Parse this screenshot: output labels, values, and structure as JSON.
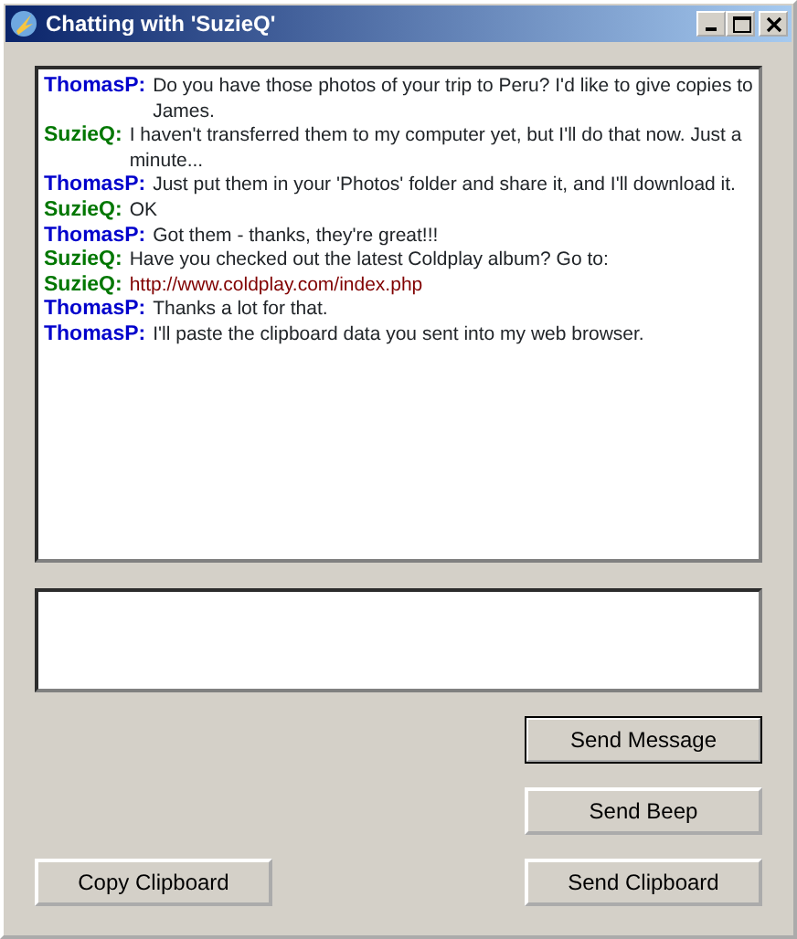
{
  "window": {
    "title": "Chatting with 'SuzieQ'"
  },
  "messages": [
    {
      "sender": "ThomasP:",
      "color": "#0000cc",
      "kind": "text",
      "text": "Do you have those photos of your trip to Peru? I'd like to give copies to James."
    },
    {
      "sender": "SuzieQ:",
      "color": "#007700",
      "kind": "text",
      "text": "I haven't transferred them to my computer yet, but I'll do that now. Just a minute..."
    },
    {
      "sender": "ThomasP:",
      "color": "#0000cc",
      "kind": "text",
      "text": "Just put them in your 'Photos' folder and share it, and I'll download it."
    },
    {
      "sender": "SuzieQ:",
      "color": "#007700",
      "kind": "text",
      "text": "OK"
    },
    {
      "sender": "ThomasP:",
      "color": "#0000cc",
      "kind": "text",
      "text": "Got them - thanks, they're great!!!"
    },
    {
      "sender": "SuzieQ:",
      "color": "#007700",
      "kind": "text",
      "text": "Have you checked out the latest Coldplay album? Go to:"
    },
    {
      "sender": "SuzieQ:",
      "color": "#007700",
      "kind": "link",
      "text": "http://www.coldplay.com/index.php"
    },
    {
      "sender": "ThomasP:",
      "color": "#0000cc",
      "kind": "text",
      "text": "Thanks a lot for that."
    },
    {
      "sender": "ThomasP:",
      "color": "#0000cc",
      "kind": "text",
      "text": "I'll paste the clipboard data you sent into my web browser."
    }
  ],
  "buttons": {
    "send_message": {
      "label": "Send Message",
      "default": true
    },
    "send_beep": {
      "label": "Send Beep",
      "default": false
    },
    "copy_clipboard": {
      "label": "Copy Clipboard",
      "default": false
    },
    "send_clipboard": {
      "label": "Send Clipboard",
      "default": false
    }
  }
}
